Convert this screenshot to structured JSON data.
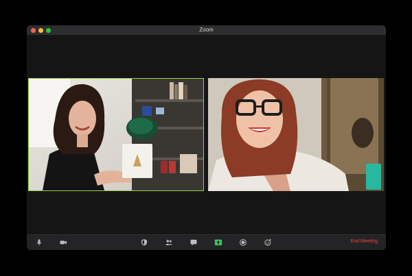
{
  "window": {
    "title": "Zoom",
    "accent": "#9dd04a"
  },
  "participants": [
    {
      "name": "",
      "role": "active-speaker"
    },
    {
      "name": "",
      "role": "participant"
    }
  ],
  "toolbar": {
    "end_label": "End Meeting",
    "end_color": "#e8483a",
    "share_color": "#35c759",
    "icons": [
      "microphone-icon",
      "video-camera-icon",
      "security-shield-icon",
      "participants-icon",
      "chat-icon",
      "share-screen-icon",
      "record-icon",
      "reactions-icon"
    ]
  }
}
